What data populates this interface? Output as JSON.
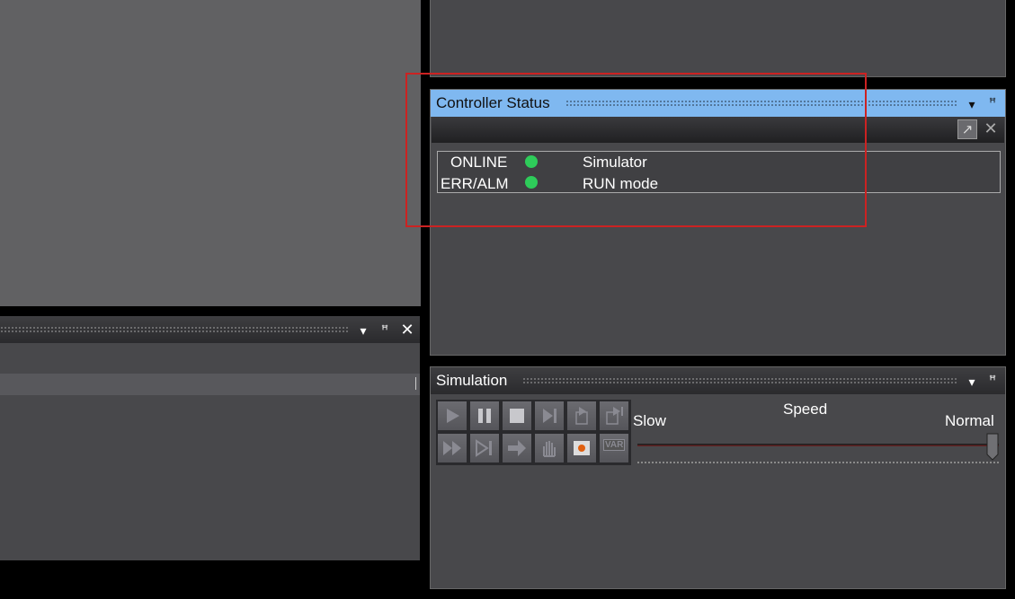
{
  "controller_status": {
    "title": "Controller Status",
    "rows": [
      {
        "label": "ONLINE",
        "status_color": "#2ecc5a",
        "value": "Simulator"
      },
      {
        "label": "ERR/ALM",
        "status_color": "#2ecc5a",
        "value": "RUN mode"
      }
    ]
  },
  "simulation": {
    "title": "Simulation",
    "speed_label": "Speed",
    "slow_label": "Slow",
    "normal_label": "Normal",
    "speed_level": 1.0,
    "buttons_row1": [
      "play-icon",
      "pause-icon",
      "stop-icon",
      "step-icon",
      "step-in-icon",
      "step-out-icon"
    ],
    "buttons_row2": [
      "fast-forward-icon",
      "step-to-end-icon",
      "arrow-right-icon",
      "hand-icon",
      "record-icon",
      "var-icon"
    ],
    "var_text": "VAR"
  },
  "colors": {
    "accent": "#7fb8f0",
    "status_green": "#2ecc5a",
    "highlight_box": "#cc2222"
  }
}
